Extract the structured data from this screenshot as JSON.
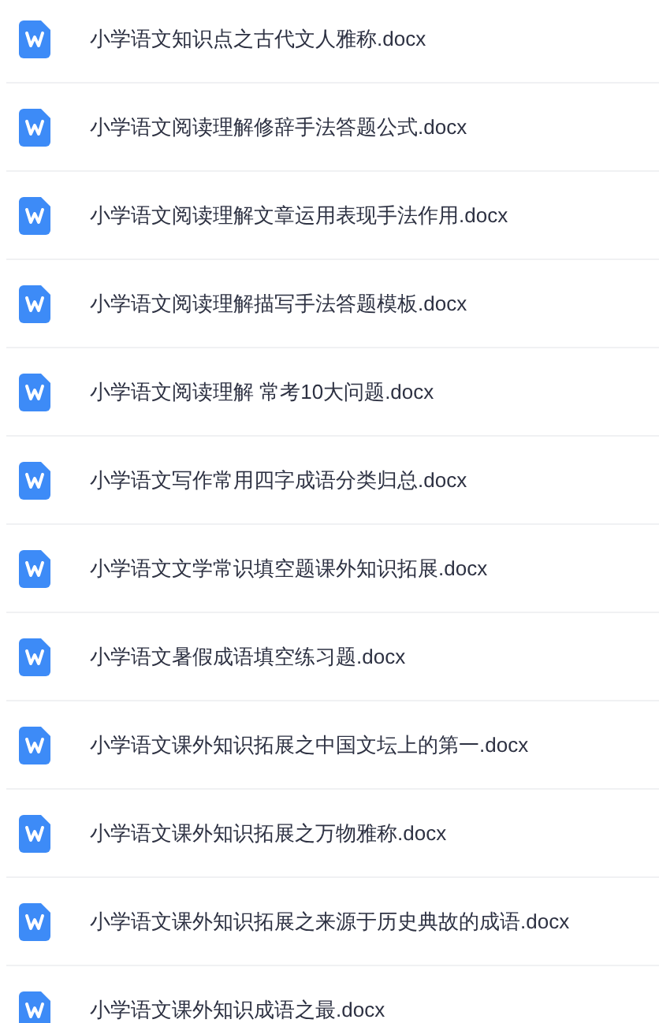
{
  "files": [
    {
      "name": "小学语文知识点之古代文人雅称.docx"
    },
    {
      "name": "小学语文阅读理解修辞手法答题公式.docx"
    },
    {
      "name": "小学语文阅读理解文章运用表现手法作用.docx"
    },
    {
      "name": "小学语文阅读理解描写手法答题模板.docx"
    },
    {
      "name": "小学语文阅读理解 常考10大问题.docx"
    },
    {
      "name": "小学语文写作常用四字成语分类归总.docx"
    },
    {
      "name": "小学语文文学常识填空题课外知识拓展.docx"
    },
    {
      "name": "小学语文暑假成语填空练习题.docx"
    },
    {
      "name": "小学语文课外知识拓展之中国文坛上的第一.docx"
    },
    {
      "name": "小学语文课外知识拓展之万物雅称.docx"
    },
    {
      "name": "小学语文课外知识拓展之来源于历史典故的成语.docx"
    },
    {
      "name": "小学语文课外知识成语之最.docx"
    }
  ]
}
